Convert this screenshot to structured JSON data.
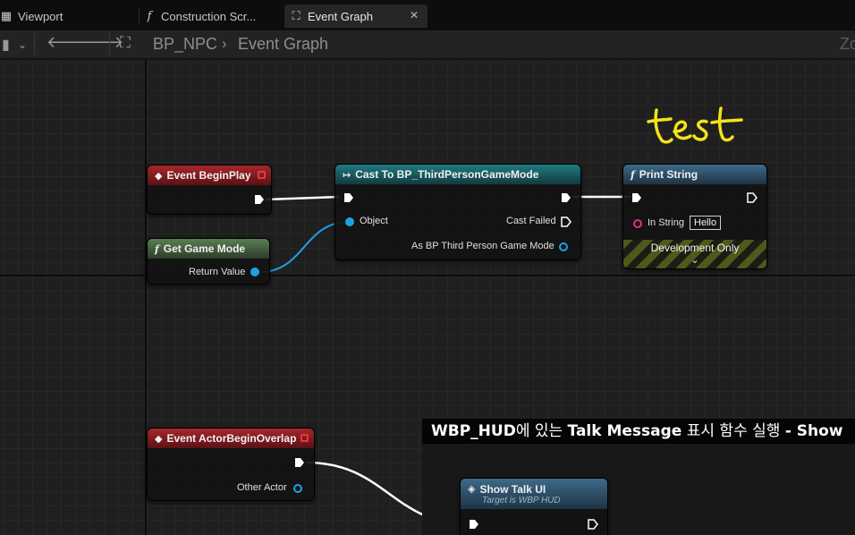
{
  "tabs": [
    {
      "label": "Viewport",
      "icon": "grid-icon"
    },
    {
      "label": "Construction Scr...",
      "icon": "function-icon"
    },
    {
      "label": "Event Graph",
      "icon": "graph-icon",
      "active": true
    }
  ],
  "toolbar": {
    "breadcrumb": [
      "BP_NPC",
      "Event Graph"
    ],
    "zoom_text": "Zo"
  },
  "nodes": {
    "begin_play": {
      "title": "Event BeginPlay"
    },
    "get_game_mode": {
      "title": "Get Game Mode",
      "output": "Return Value"
    },
    "cast": {
      "title": "Cast To BP_ThirdPersonGameMode",
      "input_object": "Object",
      "cast_failed": "Cast Failed",
      "output": "As BP Third Person Game Mode"
    },
    "print_string": {
      "title": "Print String",
      "in_string_label": "In String",
      "in_string_value": "Hello",
      "dev_only": "Development Only"
    },
    "actor_overlap": {
      "title": "Event ActorBeginOverlap",
      "other_actor": "Other Actor"
    },
    "show_talk": {
      "title": "Show Talk UI",
      "subtitle": "Target is WBP HUD"
    }
  },
  "annotation": {
    "part1": "WBP_HUD",
    "part2": "에 있는 ",
    "part3": "Talk Message",
    "part4": " 표시 함수 실행 ",
    "part5": "- Show"
  },
  "handwriting": "test",
  "colors": {
    "exec_wire": "#ffffff",
    "object_wire": "#1aa3e6",
    "event_header": "#a8262c",
    "cast_header": "#1f7b80",
    "function_header": "#3d6a8a",
    "pure_header": "#5a7e52",
    "handwriting": "#f4e21a"
  }
}
